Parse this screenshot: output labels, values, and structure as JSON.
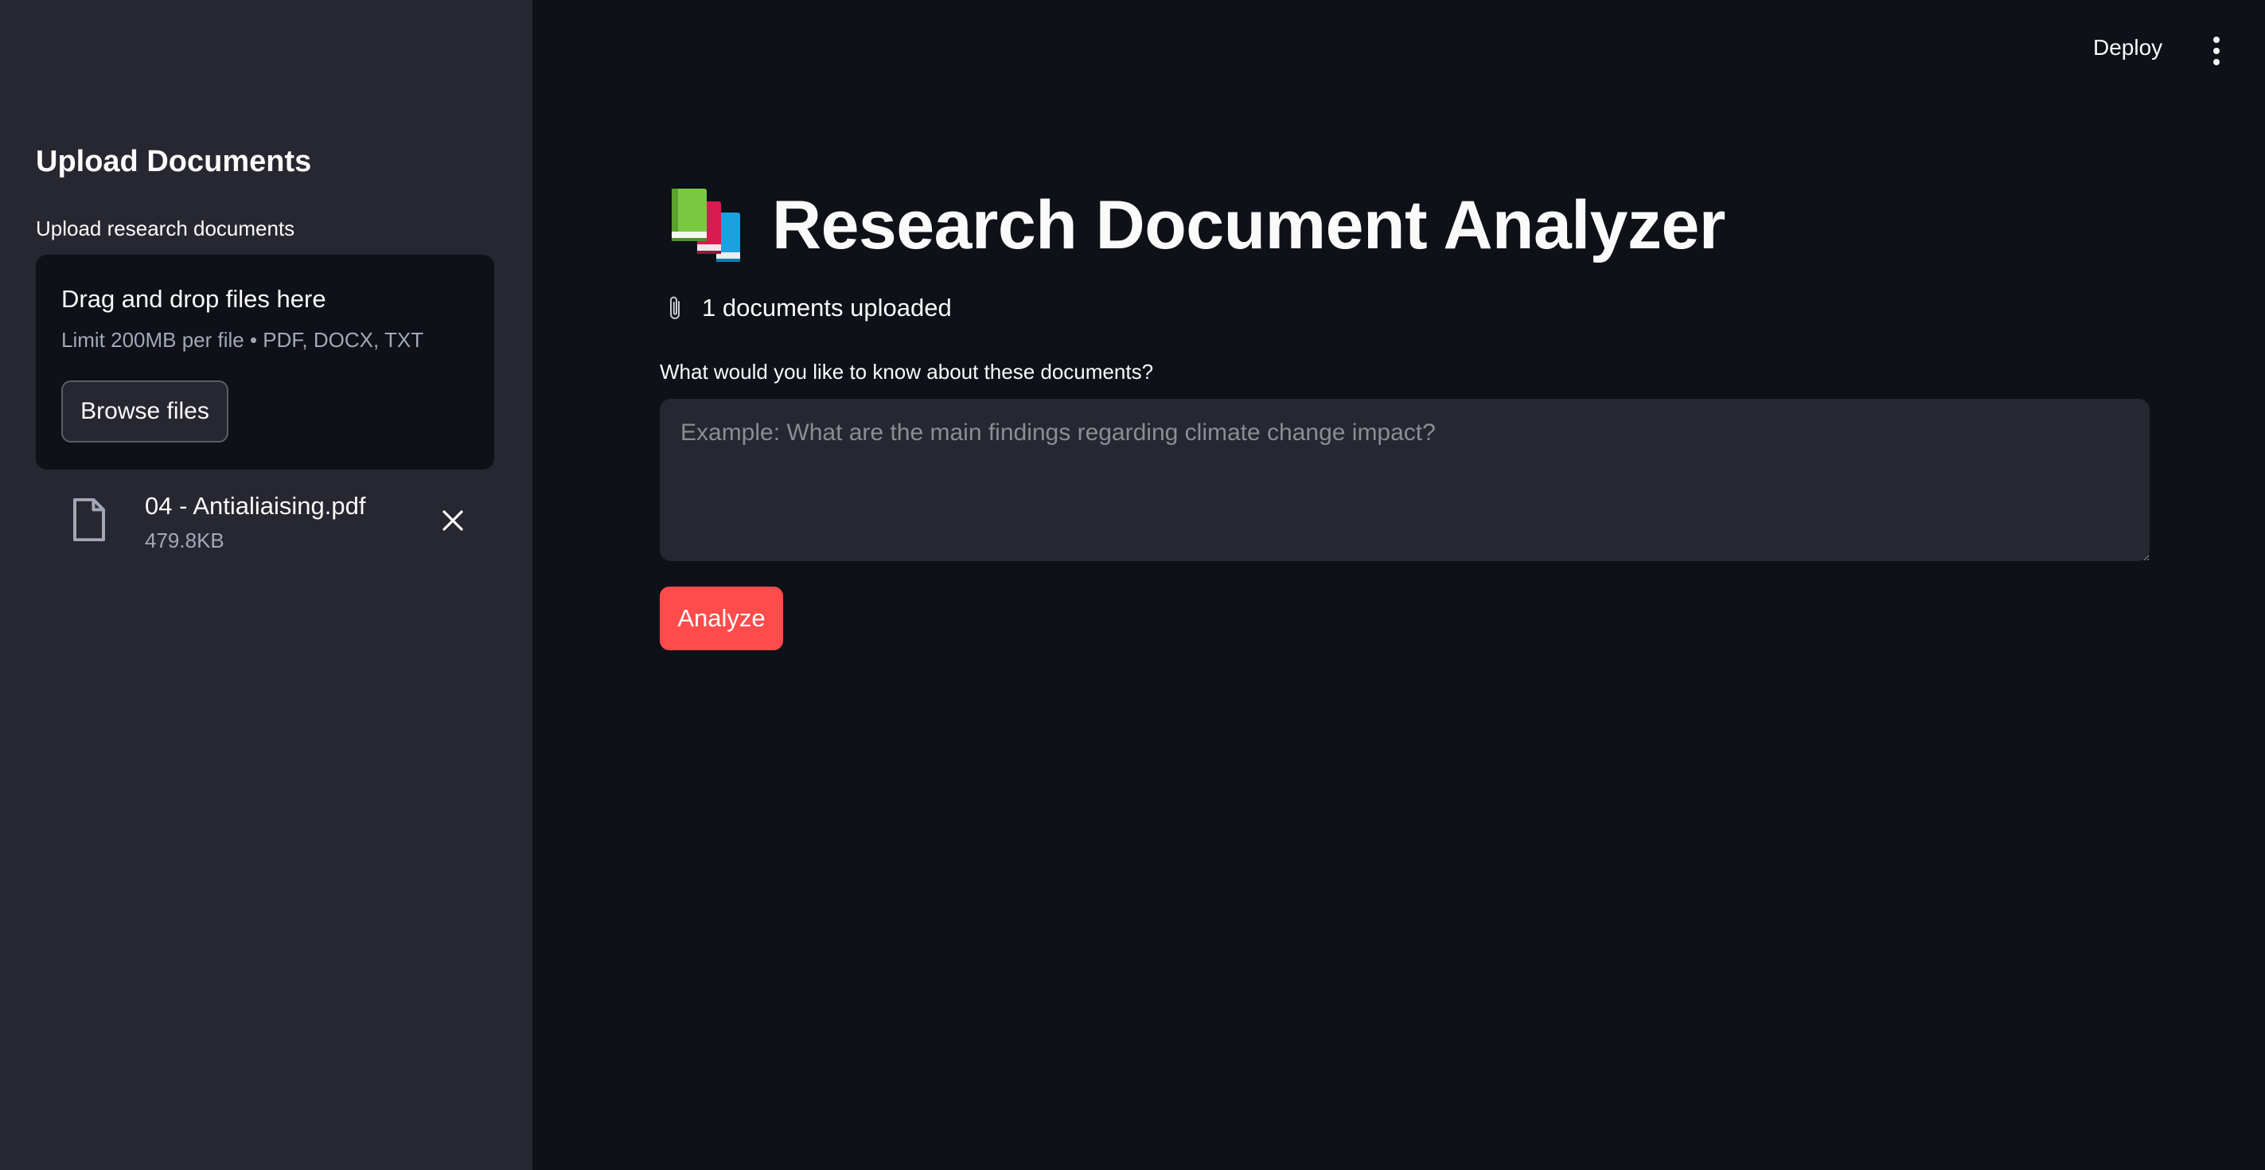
{
  "header": {
    "deploy_label": "Deploy",
    "menu_icon": "kebab-menu-icon"
  },
  "sidebar": {
    "title": "Upload Documents",
    "uploader": {
      "label": "Upload research documents",
      "dropzone_title": "Drag and drop files here",
      "dropzone_subtitle": "Limit 200MB per file • PDF, DOCX, TXT",
      "browse_label": "Browse files"
    },
    "files": [
      {
        "icon": "file-icon",
        "name": "04 - Antialiaising.pdf",
        "size": "479.8KB",
        "remove_icon": "close-icon"
      }
    ]
  },
  "main": {
    "title_icon": "books-icon",
    "title": "Research Document Analyzer",
    "status_icon": "paperclip-icon",
    "status_text": "1 documents uploaded",
    "question": {
      "label": "What would you like to know about these documents?",
      "value": "",
      "placeholder": "Example: What are the main findings regarding climate change impact?"
    },
    "analyze_label": "Analyze"
  },
  "colors": {
    "background": "#0e1117",
    "sidebar": "#262730",
    "input": "#262730",
    "primary": "#ff4b4b",
    "text": "#fafafa",
    "muted": "#a3a8b8"
  }
}
